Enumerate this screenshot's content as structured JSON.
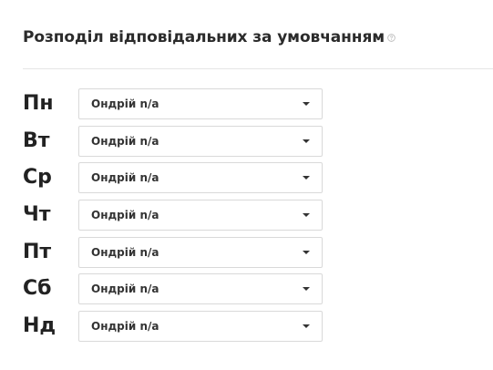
{
  "header": {
    "title": "Розподіл відповідальних за умовчанням",
    "help_icon": "question-circle-icon"
  },
  "schedule": [
    {
      "day": "Пн",
      "selected": "Ондрій n/a"
    },
    {
      "day": "Вт",
      "selected": "Ондрій n/a"
    },
    {
      "day": "Ср",
      "selected": "Ондрій n/a"
    },
    {
      "day": "Чт",
      "selected": "Ондрій n/a"
    },
    {
      "day": "Пт",
      "selected": "Ондрій n/a"
    },
    {
      "day": "Сб",
      "selected": "Ондрій n/a"
    },
    {
      "day": "Нд",
      "selected": "Ондрій n/a"
    }
  ],
  "colors": {
    "text": "#222222",
    "border": "#d9d9d9",
    "divider": "#e5e5e5"
  }
}
